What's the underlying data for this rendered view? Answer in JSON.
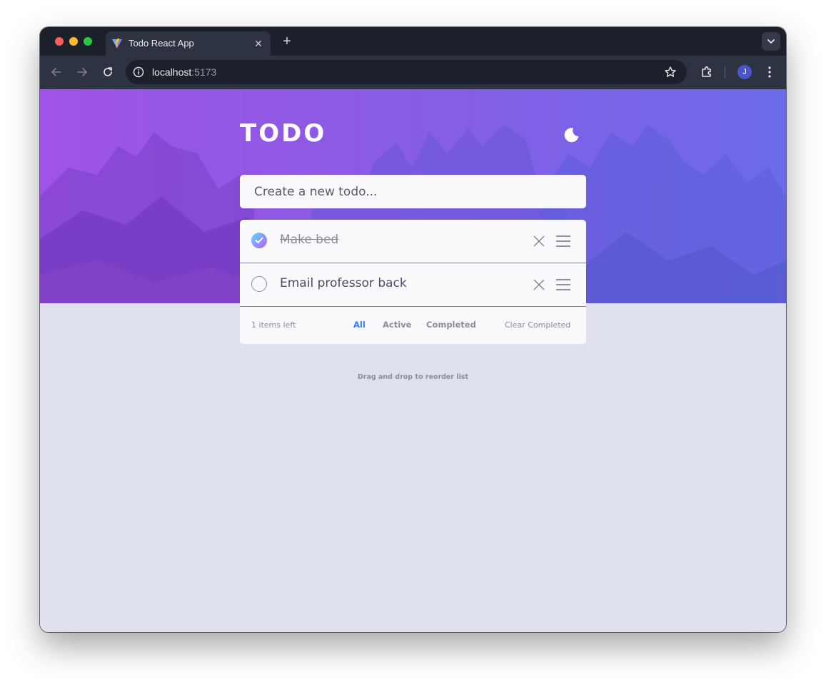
{
  "browser": {
    "tab_title": "Todo React App",
    "tab_close_glyph": "✕",
    "new_tab_glyph": "+",
    "url_host": "localhost",
    "url_port": ":5173",
    "profile_initial": "J",
    "colors": {
      "frame": "#1b202b",
      "toolbar": "#2d3340",
      "avatar": "#4956c9"
    },
    "icons": [
      "back-icon",
      "forward-icon",
      "reload-icon",
      "info-icon",
      "bookmark-star-icon",
      "extensions-icon",
      "more-menu-icon",
      "tab-search-icon"
    ]
  },
  "app": {
    "title": "TODO",
    "theme_toggle_icon": "moon-icon",
    "new_todo_placeholder": "Create a new todo...",
    "new_todo_value": "",
    "todos": [
      {
        "text": "Make bed",
        "completed": true
      },
      {
        "text": "Email professor back",
        "completed": false
      }
    ],
    "footer": {
      "items_left": "1 items left",
      "filters": [
        "All",
        "Active",
        "Completed"
      ],
      "active_filter": "All",
      "clear_label": "Clear Completed"
    },
    "hint": "Drag and drop to reorder list",
    "colors": {
      "hero_gradient_start": "#a053e6",
      "hero_gradient_end": "#6c6ae8",
      "check_gradient_start": "#57ddff",
      "check_gradient_end": "#c058f3",
      "active_filter": "#3a7bfd",
      "page_background": "#dfe1ee",
      "card_background": "#f9f9fb"
    }
  }
}
